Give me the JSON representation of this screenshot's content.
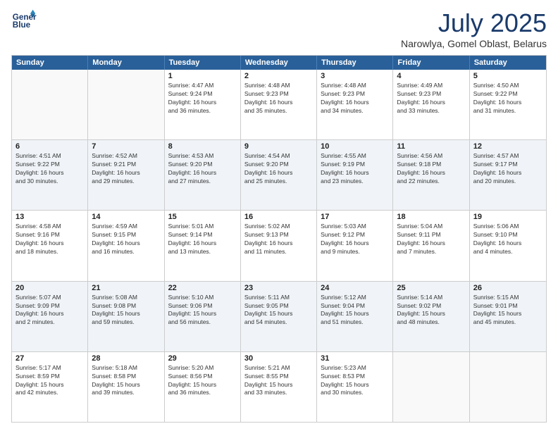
{
  "logo": {
    "line1": "General",
    "line2": "Blue"
  },
  "title": "July 2025",
  "location": "Narowlya, Gomel Oblast, Belarus",
  "header_days": [
    "Sunday",
    "Monday",
    "Tuesday",
    "Wednesday",
    "Thursday",
    "Friday",
    "Saturday"
  ],
  "rows": [
    [
      {
        "day": "",
        "info": ""
      },
      {
        "day": "",
        "info": ""
      },
      {
        "day": "1",
        "info": "Sunrise: 4:47 AM\nSunset: 9:24 PM\nDaylight: 16 hours\nand 36 minutes."
      },
      {
        "day": "2",
        "info": "Sunrise: 4:48 AM\nSunset: 9:23 PM\nDaylight: 16 hours\nand 35 minutes."
      },
      {
        "day": "3",
        "info": "Sunrise: 4:48 AM\nSunset: 9:23 PM\nDaylight: 16 hours\nand 34 minutes."
      },
      {
        "day": "4",
        "info": "Sunrise: 4:49 AM\nSunset: 9:23 PM\nDaylight: 16 hours\nand 33 minutes."
      },
      {
        "day": "5",
        "info": "Sunrise: 4:50 AM\nSunset: 9:22 PM\nDaylight: 16 hours\nand 31 minutes."
      }
    ],
    [
      {
        "day": "6",
        "info": "Sunrise: 4:51 AM\nSunset: 9:22 PM\nDaylight: 16 hours\nand 30 minutes."
      },
      {
        "day": "7",
        "info": "Sunrise: 4:52 AM\nSunset: 9:21 PM\nDaylight: 16 hours\nand 29 minutes."
      },
      {
        "day": "8",
        "info": "Sunrise: 4:53 AM\nSunset: 9:20 PM\nDaylight: 16 hours\nand 27 minutes."
      },
      {
        "day": "9",
        "info": "Sunrise: 4:54 AM\nSunset: 9:20 PM\nDaylight: 16 hours\nand 25 minutes."
      },
      {
        "day": "10",
        "info": "Sunrise: 4:55 AM\nSunset: 9:19 PM\nDaylight: 16 hours\nand 23 minutes."
      },
      {
        "day": "11",
        "info": "Sunrise: 4:56 AM\nSunset: 9:18 PM\nDaylight: 16 hours\nand 22 minutes."
      },
      {
        "day": "12",
        "info": "Sunrise: 4:57 AM\nSunset: 9:17 PM\nDaylight: 16 hours\nand 20 minutes."
      }
    ],
    [
      {
        "day": "13",
        "info": "Sunrise: 4:58 AM\nSunset: 9:16 PM\nDaylight: 16 hours\nand 18 minutes."
      },
      {
        "day": "14",
        "info": "Sunrise: 4:59 AM\nSunset: 9:15 PM\nDaylight: 16 hours\nand 16 minutes."
      },
      {
        "day": "15",
        "info": "Sunrise: 5:01 AM\nSunset: 9:14 PM\nDaylight: 16 hours\nand 13 minutes."
      },
      {
        "day": "16",
        "info": "Sunrise: 5:02 AM\nSunset: 9:13 PM\nDaylight: 16 hours\nand 11 minutes."
      },
      {
        "day": "17",
        "info": "Sunrise: 5:03 AM\nSunset: 9:12 PM\nDaylight: 16 hours\nand 9 minutes."
      },
      {
        "day": "18",
        "info": "Sunrise: 5:04 AM\nSunset: 9:11 PM\nDaylight: 16 hours\nand 7 minutes."
      },
      {
        "day": "19",
        "info": "Sunrise: 5:06 AM\nSunset: 9:10 PM\nDaylight: 16 hours\nand 4 minutes."
      }
    ],
    [
      {
        "day": "20",
        "info": "Sunrise: 5:07 AM\nSunset: 9:09 PM\nDaylight: 16 hours\nand 2 minutes."
      },
      {
        "day": "21",
        "info": "Sunrise: 5:08 AM\nSunset: 9:08 PM\nDaylight: 15 hours\nand 59 minutes."
      },
      {
        "day": "22",
        "info": "Sunrise: 5:10 AM\nSunset: 9:06 PM\nDaylight: 15 hours\nand 56 minutes."
      },
      {
        "day": "23",
        "info": "Sunrise: 5:11 AM\nSunset: 9:05 PM\nDaylight: 15 hours\nand 54 minutes."
      },
      {
        "day": "24",
        "info": "Sunrise: 5:12 AM\nSunset: 9:04 PM\nDaylight: 15 hours\nand 51 minutes."
      },
      {
        "day": "25",
        "info": "Sunrise: 5:14 AM\nSunset: 9:02 PM\nDaylight: 15 hours\nand 48 minutes."
      },
      {
        "day": "26",
        "info": "Sunrise: 5:15 AM\nSunset: 9:01 PM\nDaylight: 15 hours\nand 45 minutes."
      }
    ],
    [
      {
        "day": "27",
        "info": "Sunrise: 5:17 AM\nSunset: 8:59 PM\nDaylight: 15 hours\nand 42 minutes."
      },
      {
        "day": "28",
        "info": "Sunrise: 5:18 AM\nSunset: 8:58 PM\nDaylight: 15 hours\nand 39 minutes."
      },
      {
        "day": "29",
        "info": "Sunrise: 5:20 AM\nSunset: 8:56 PM\nDaylight: 15 hours\nand 36 minutes."
      },
      {
        "day": "30",
        "info": "Sunrise: 5:21 AM\nSunset: 8:55 PM\nDaylight: 15 hours\nand 33 minutes."
      },
      {
        "day": "31",
        "info": "Sunrise: 5:23 AM\nSunset: 8:53 PM\nDaylight: 15 hours\nand 30 minutes."
      },
      {
        "day": "",
        "info": ""
      },
      {
        "day": "",
        "info": ""
      }
    ]
  ]
}
